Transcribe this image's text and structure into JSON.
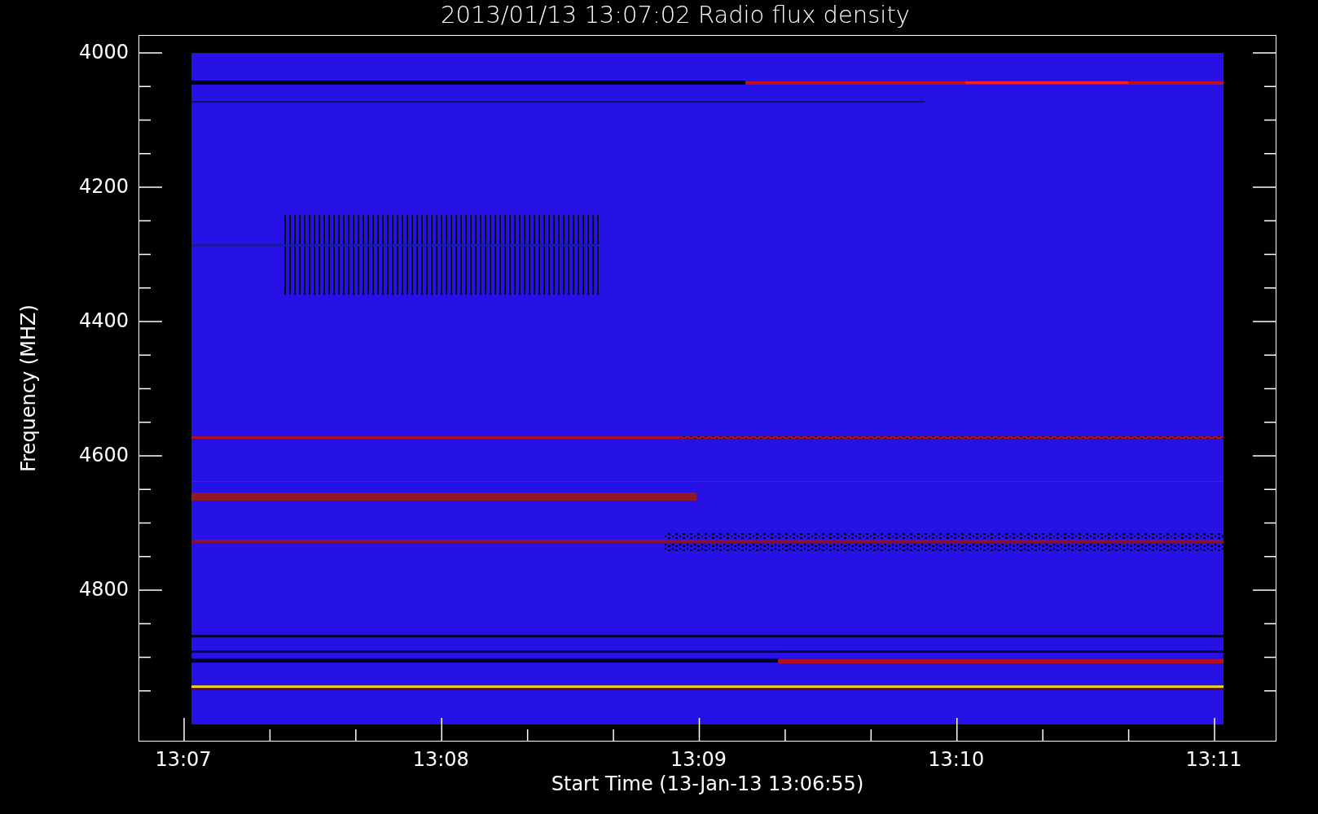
{
  "title": "2013/01/13 13:07:02 Radio flux density",
  "y_axis": {
    "label": "Frequency (MHZ)",
    "ticks": [
      "4000",
      "4200",
      "4400",
      "4600",
      "4800"
    ]
  },
  "x_axis": {
    "label": "Start Time (13-Jan-13 13:06:55)",
    "ticks": [
      "13:07",
      "13:08",
      "13:09",
      "13:10",
      "13:11"
    ]
  }
}
